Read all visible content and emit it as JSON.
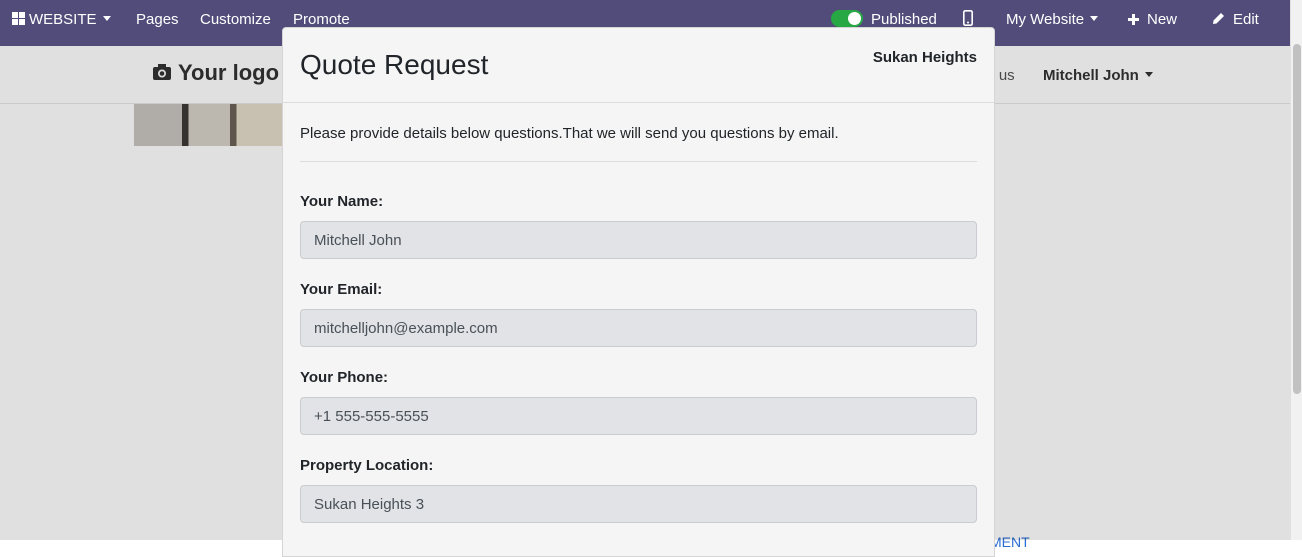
{
  "topbar": {
    "apps_label": "WEBSITE",
    "pages_label": "Pages",
    "customize_label": "Customize",
    "promote_label": "Promote",
    "published_label": "Published",
    "website_selector": "My Website",
    "new_label": "New",
    "edit_label": "Edit",
    "color": "#524c7a"
  },
  "site": {
    "logo_text": "Your logo",
    "contact_label": "ct us",
    "user_name": "Mitchell John",
    "bottom_link": "MENT"
  },
  "modal": {
    "title": "Quote Request",
    "subtitle": "Sukan Heights",
    "intro": "Please provide details below questions.That we will send you questions by email.",
    "fields": [
      {
        "label": "Your Name:",
        "value": "Mitchell John"
      },
      {
        "label": "Your Email:",
        "value": "mitchelljohn@example.com"
      },
      {
        "label": "Your Phone:",
        "value": "+1 555-555-5555"
      },
      {
        "label": "Property Location:",
        "value": "Sukan Heights 3"
      }
    ]
  }
}
